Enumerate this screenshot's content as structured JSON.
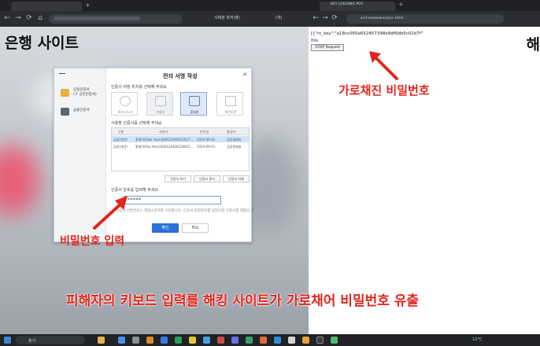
{
  "left_browser": {
    "bookmarks": [
      "사례분 최저(플)",
      "(게)"
    ],
    "site_label": "은행 사이트",
    "dialog": {
      "title": "전자 서명 작성",
      "close": "✕",
      "side_items": [
        "공동인증서\n(구 공인인증서)",
        "금융인증서"
      ],
      "section_storage": "인증서 저장 위치를 선택해 주세요",
      "stores": [
        "하드디스크",
        "이동식",
        "휴대폰",
        "보안토큰",
        "금융인증서",
        "브라우저"
      ],
      "selected_store": "휴대폰",
      "section_select": "사용할 인증서를 선택해 주세요",
      "table_headers": [
        "구분",
        "사용자",
        "만료일",
        "발급자"
      ],
      "rows": [
        {
          "type": "금융(개인)",
          "user": "홍재이(Taek Yoon)00012440022017...",
          "expiry": "2024-09-01",
          "issuer": "금융결제원"
        },
        {
          "type": "금융(개인)",
          "user": "홍재이(Yoo Yoon)000124400220015...",
          "expiry": "2024-09-01",
          "issuer": "금융결제원"
        }
      ],
      "buttons_small": [
        "인증서 보기",
        "인증서 찾기",
        "인증서 삭제"
      ],
      "section_password": "인증서 암호를 입력해 주세요",
      "password_value": "*****",
      "hint": "인증서 비밀번호는 영대소문자를 구분합니다. 인증서 비밀번호를 잊었다면 인증서를 재발급 받으셔야 합니다.",
      "ok": "확인",
      "cancel": "취소"
    },
    "annotation_password": "비밀번호 입력"
  },
  "right_browser": {
    "tab_title": "KEY LOGGING POC",
    "url": "ssrf.ssswww.kr/poc.html",
    "log_line": "[{\"rc_key\":\"a18cc065e652457398e9df6db5c02d7f\"",
    "log_line2": "this",
    "stop_button": "STOP Request",
    "cut_text": "해",
    "annotation": "가로채진 비밀번호"
  },
  "caption": "피해자의 키보드 입력를 해킹 사이트가 가로채어 비밀번호 유출",
  "taskbar": {
    "search": "찾기",
    "weather": "12°C"
  },
  "colors": {
    "annotation_red": "#e1261c",
    "accent_blue": "#2c6fd6"
  }
}
